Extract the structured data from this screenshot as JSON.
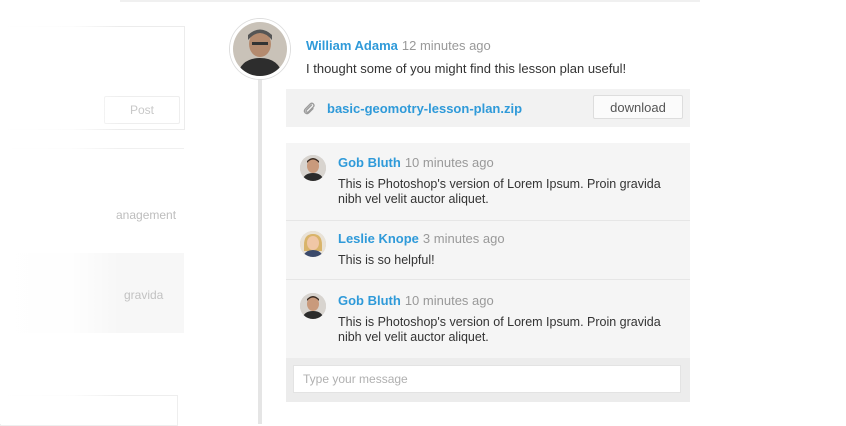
{
  "background": {
    "post_label": "Post",
    "text_1": "anagement",
    "text_2": "gravida"
  },
  "post": {
    "author": "William Adama",
    "time": "12 minutes ago",
    "text": "I thought some of you might find this lesson plan useful!",
    "attachment": {
      "icon": "paperclip-icon",
      "filename": "basic-geomotry-lesson-plan.zip",
      "download_label": "download"
    }
  },
  "comments": [
    {
      "author": "Gob Bluth",
      "time": "10 minutes ago",
      "text_line_1": "This is Photoshop's version  of Lorem Ipsum. Proin gravida",
      "text_line_2": "nibh vel velit auctor aliquet."
    },
    {
      "author": "Leslie Knope",
      "time": "3 minutes ago",
      "text_line_1": "This is so helpful!",
      "text_line_2": ""
    },
    {
      "author": "Gob Bluth",
      "time": "10 minutes ago",
      "text_line_1": "This is Photoshop's version  of Lorem Ipsum. Proin gravida",
      "text_line_2": "nibh vel velit auctor aliquet."
    }
  ],
  "composer": {
    "placeholder": "Type your message"
  },
  "colors": {
    "accent": "#2f9ad9",
    "muted": "#999999",
    "panel": "#f5f5f5"
  }
}
